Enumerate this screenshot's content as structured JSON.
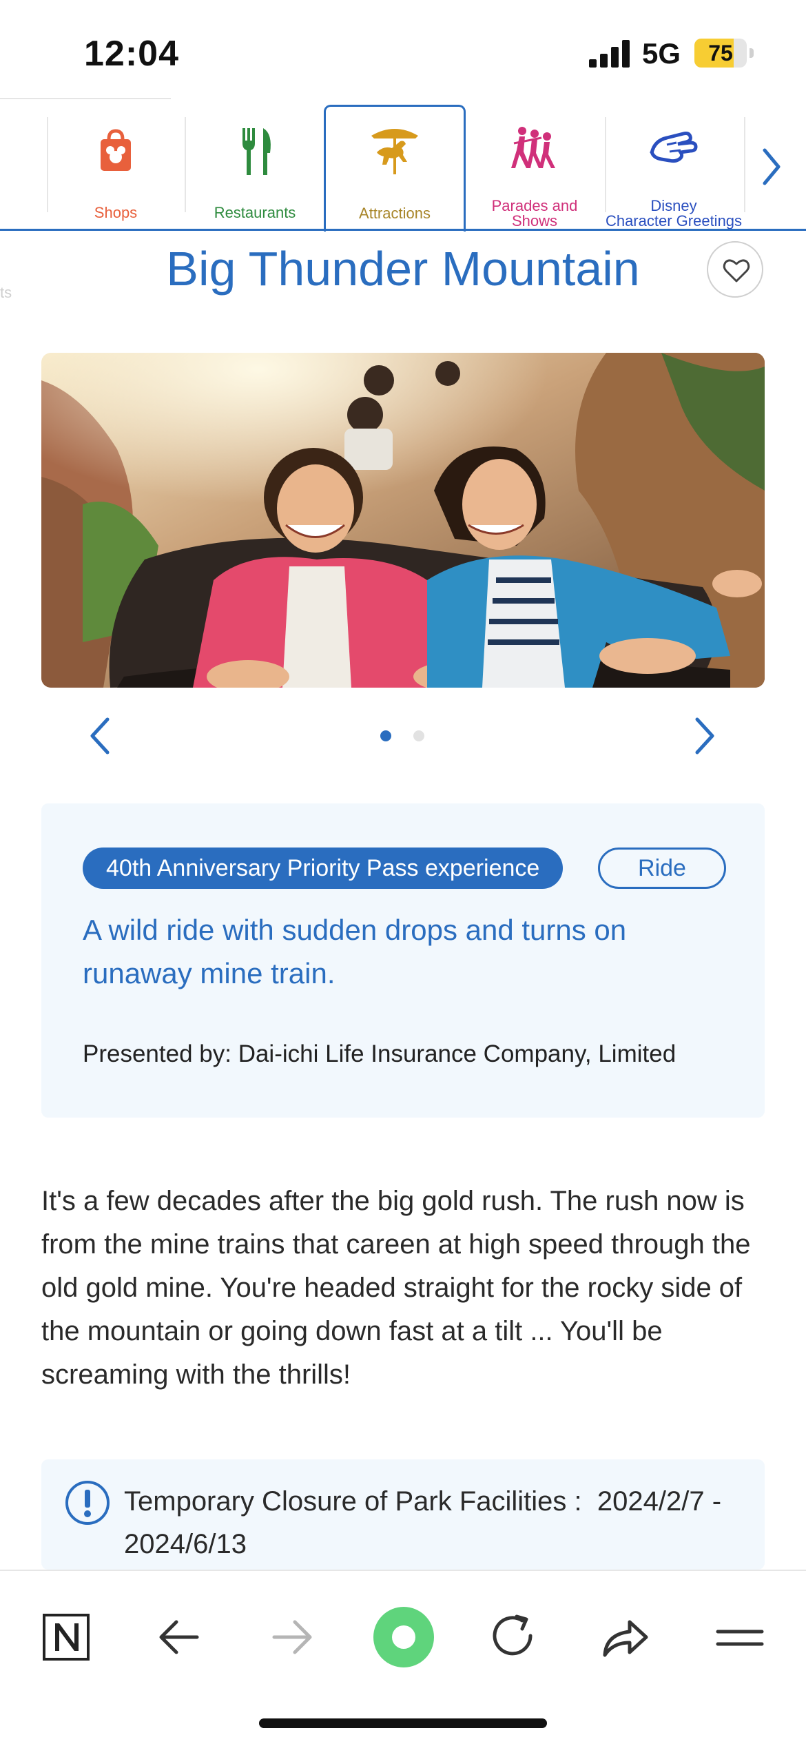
{
  "status_bar": {
    "time": "12:04",
    "network": "5G",
    "battery": "75",
    "battery_level": 0.75
  },
  "category_nav": {
    "partial_left_label": "ts",
    "items": [
      {
        "label": "Shops",
        "icon": "shopping-bag-icon",
        "color": "#e8603c"
      },
      {
        "label": "Restaurants",
        "icon": "fork-knife-icon",
        "color": "#2e8b3e"
      },
      {
        "label": "Attractions",
        "icon": "carousel-horse-icon",
        "color": "#a8862a",
        "active": true
      },
      {
        "label_line1": "Parades and",
        "label_line2": "Shows",
        "icon": "parade-dancers-icon",
        "color": "#d0307a"
      },
      {
        "label_line1": "Disney",
        "label_line2": "Character Greetings",
        "icon": "glove-hand-icon",
        "color": "#2a4fbf"
      }
    ]
  },
  "page": {
    "title": "Big Thunder Mountain",
    "carousel": {
      "slides": 2,
      "current": 1
    },
    "tags": [
      "40th Anniversary Priority Pass experience",
      "Ride"
    ],
    "tagline": "A wild ride with sudden drops and turns on runaway mine train.",
    "sponsor": "Presented by: Dai-ichi Life Insurance Company, Limited",
    "description": "It's a few decades after the big gold rush. The rush now is from the mine trains that careen at high speed through the old gold mine. You're headed straight for the rocky side of the mountain or going down fast at a tilt ... You'll be screaming with the thrills!",
    "notice": "Temporary Closure of Park Facilities :  2024/2/7 - 2024/6/13"
  },
  "colors": {
    "accent": "#2a6dbf",
    "card_bg": "#f2f8fd",
    "browser_green": "#5fd47c"
  }
}
